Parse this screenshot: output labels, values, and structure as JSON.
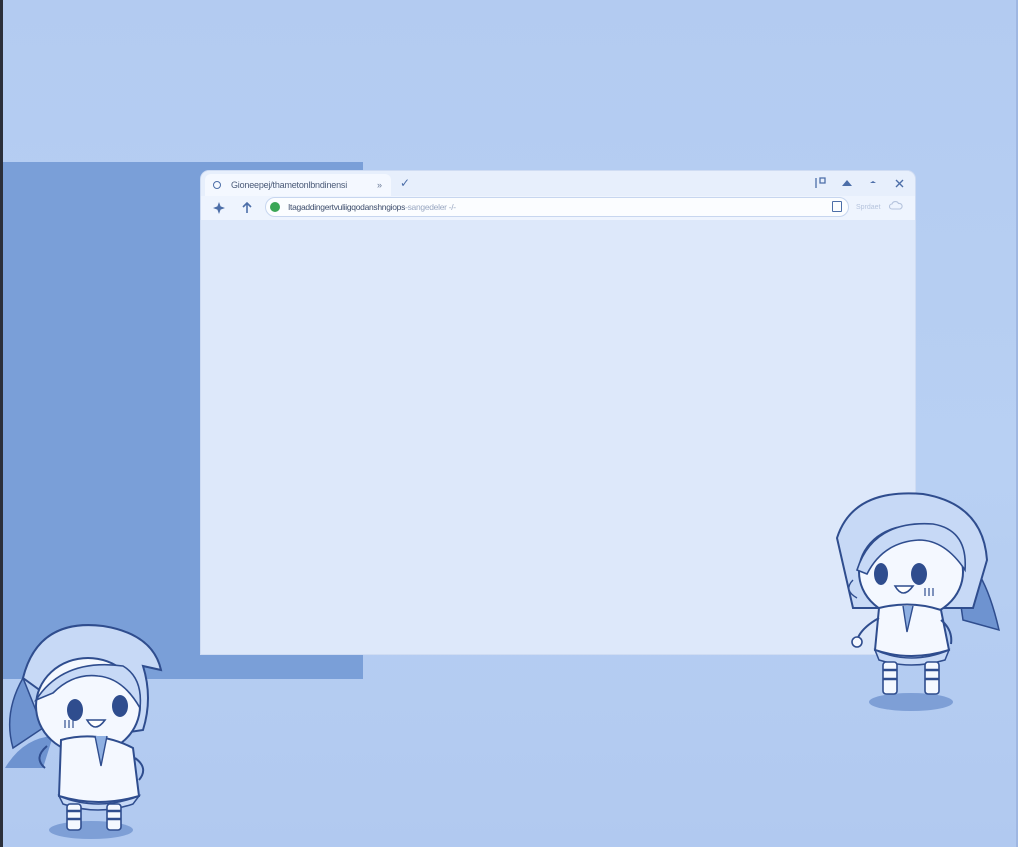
{
  "desktop": {
    "background": "#b7cff2",
    "panel_color": "#7a9fd8"
  },
  "browser": {
    "tab": {
      "title": "Gioneepej/thametonlbndinensi",
      "close_icon": "close-icon"
    },
    "new_tab_icon": "check-icon",
    "window_controls": [
      "pip-icon",
      "caret-up-icon",
      "minimize-icon",
      "close-icon"
    ],
    "toolbar": {
      "back_icon": "sparkle-icon",
      "up_icon": "arrow-up-icon",
      "url_main": "Itagaddingertvuliigqodanshngiops",
      "url_rest": "-sangedeler -/-",
      "ghost_text": "Sprdaet",
      "extension_icon": "cloud-icon"
    }
  },
  "mascots": [
    {
      "name": "chibi-character-left"
    },
    {
      "name": "chibi-character-right"
    }
  ]
}
